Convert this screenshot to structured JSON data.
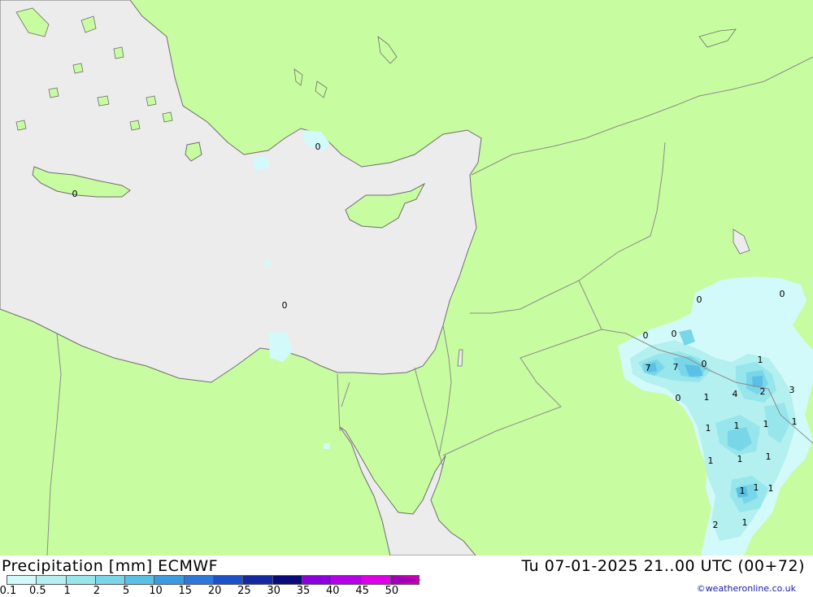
{
  "footer": {
    "title": "Precipitation [mm] ECMWF",
    "datetime": "Tu 07-01-2025 21..00 UTC (00+72)",
    "credit": "©weatheronline.co.uk"
  },
  "legend": {
    "ticks": [
      "0.1",
      "0.5",
      "1",
      "2",
      "5",
      "10",
      "15",
      "20",
      "25",
      "30",
      "35",
      "40",
      "45",
      "50"
    ],
    "colors": [
      "#d2fafa",
      "#b4f0f0",
      "#96e6ec",
      "#78d6e8",
      "#5ac0e4",
      "#3c9ade",
      "#2d78d8",
      "#1e50c8",
      "#1428a0",
      "#0a0a78",
      "#8c00dc",
      "#b400e6",
      "#dc00e6",
      "#c800b4"
    ]
  },
  "colors": {
    "land": "#c8fca0",
    "sea": "#ececec",
    "border": "#8c8c8c",
    "coast": "#6e6e6e"
  },
  "map_labels": [
    "0",
    "0",
    "0",
    "0",
    "0",
    "0",
    "0",
    "7",
    "7",
    "0",
    "1",
    "0",
    "1",
    "4",
    "2",
    "3",
    "1",
    "1",
    "1",
    "1",
    "1",
    "1",
    "1",
    "1",
    "1",
    "1",
    "2",
    "1"
  ]
}
